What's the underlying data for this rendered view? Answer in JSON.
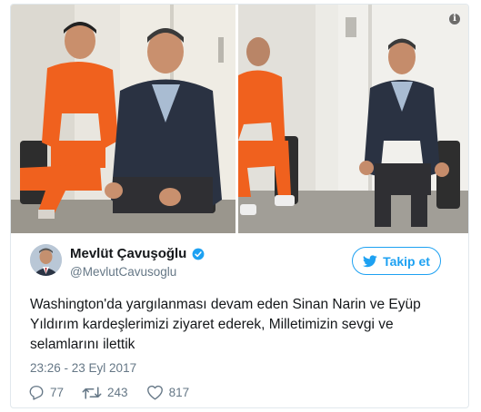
{
  "tweet": {
    "author": {
      "display_name": "Mevlüt Çavuşoğlu",
      "handle": "@MevlutCavusoglu",
      "verified": true
    },
    "follow_button": {
      "label": "Takip et",
      "icon": "twitter-bird-icon"
    },
    "text": "Washington'da yargılanması devam eden Sinan Narin ve Eyüp Yıldırım kardeşlerimizi ziyaret ederek, Milletimizin sevgi ve selamlarını ilettik",
    "timestamp": "23:26 - 23 Eyl 2017",
    "actions": {
      "reply": {
        "icon": "reply-icon",
        "count": "77"
      },
      "retweet": {
        "icon": "retweet-icon",
        "count": "243"
      },
      "like": {
        "icon": "heart-icon",
        "count": "817"
      }
    },
    "media": {
      "photo_count": 2,
      "info_icon": "info-icon",
      "info_glyph": "i"
    }
  },
  "colors": {
    "accent": "#1da1f2",
    "text": "#14171a",
    "muted": "#657786",
    "border": "#e1e8ed",
    "orange_uniform": "#f0611e",
    "suit": "#2a3242"
  }
}
